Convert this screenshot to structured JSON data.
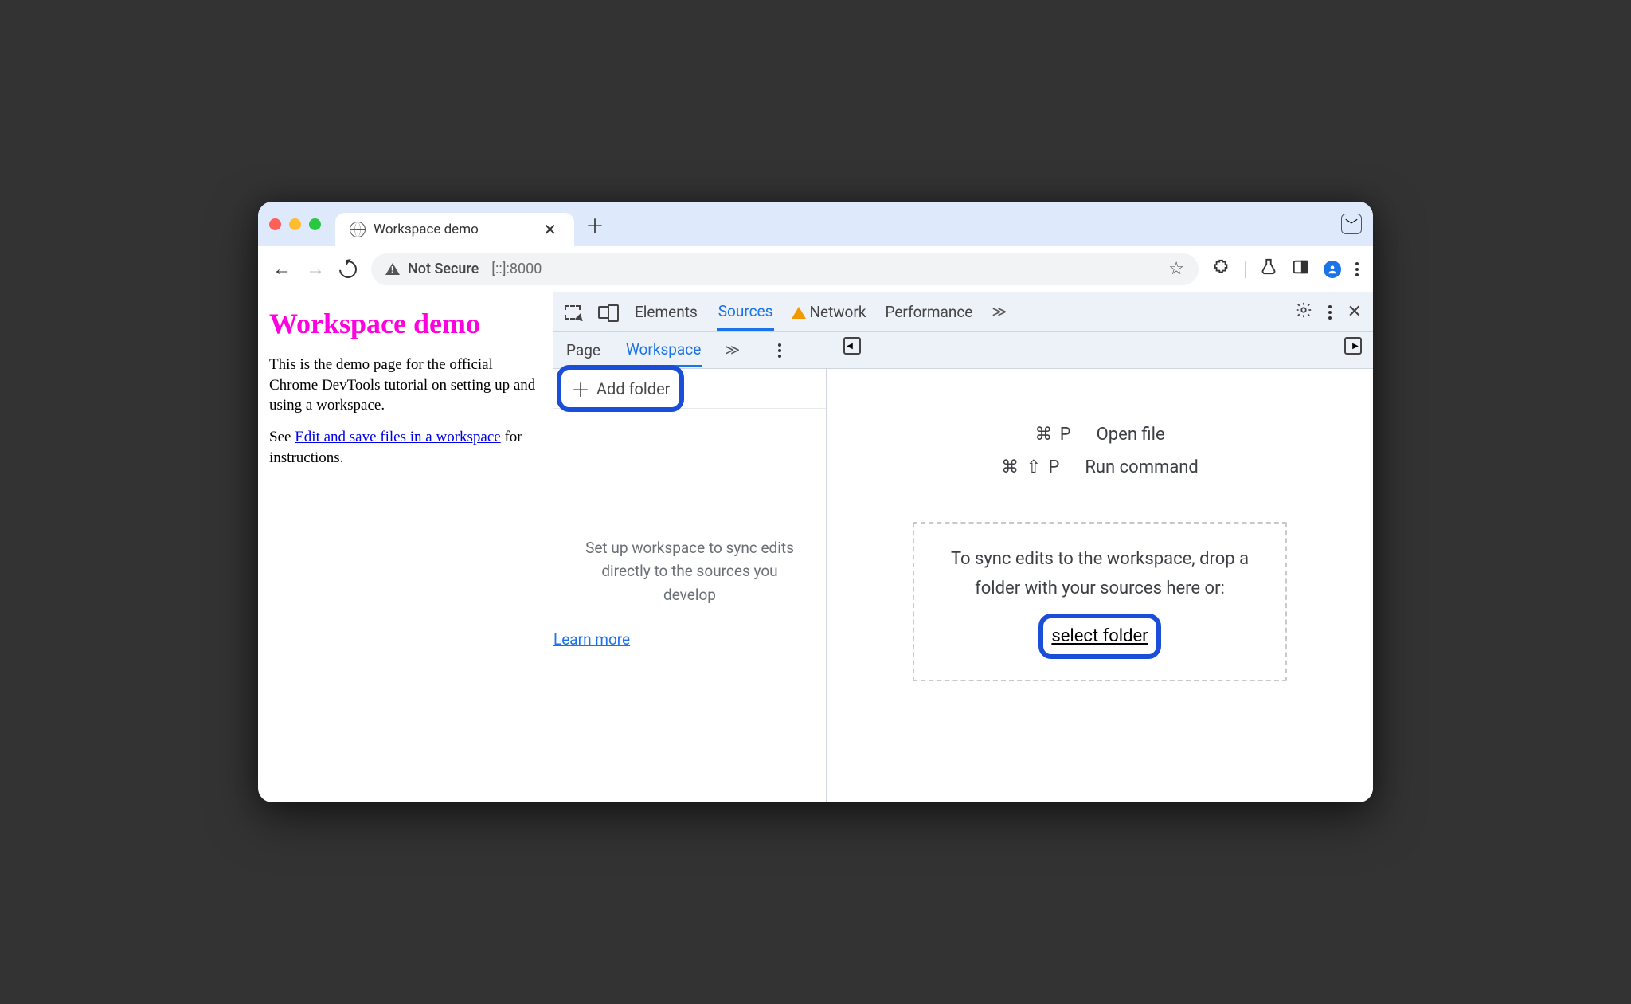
{
  "window": {
    "tab_title": "Workspace demo"
  },
  "toolbar": {
    "secure_label": "Not Secure",
    "url": "[::]:8000"
  },
  "page": {
    "heading": "Workspace demo",
    "p1": "This is the demo page for the official Chrome DevTools tutorial on setting up and using a workspace.",
    "p2_prefix": "See ",
    "link": "Edit and save files in a workspace",
    "p2_suffix": " for instructions."
  },
  "devtools": {
    "tabs": {
      "elements": "Elements",
      "sources": "Sources",
      "network": "Network",
      "performance": "Performance"
    },
    "subtabs": {
      "page": "Page",
      "workspace": "Workspace"
    },
    "add_folder": "Add folder",
    "sidebar_help": "Set up workspace to sync edits directly to the sources you develop",
    "learn_more": "Learn more",
    "shortcuts": {
      "open_file_kbd": "⌘  P",
      "open_file_label": "Open file",
      "run_cmd_kbd": "⌘  ⇧  P",
      "run_cmd_label": "Run command"
    },
    "dropzone": "To sync edits to the workspace, drop a folder with your sources here or:",
    "select_folder": "select folder"
  }
}
